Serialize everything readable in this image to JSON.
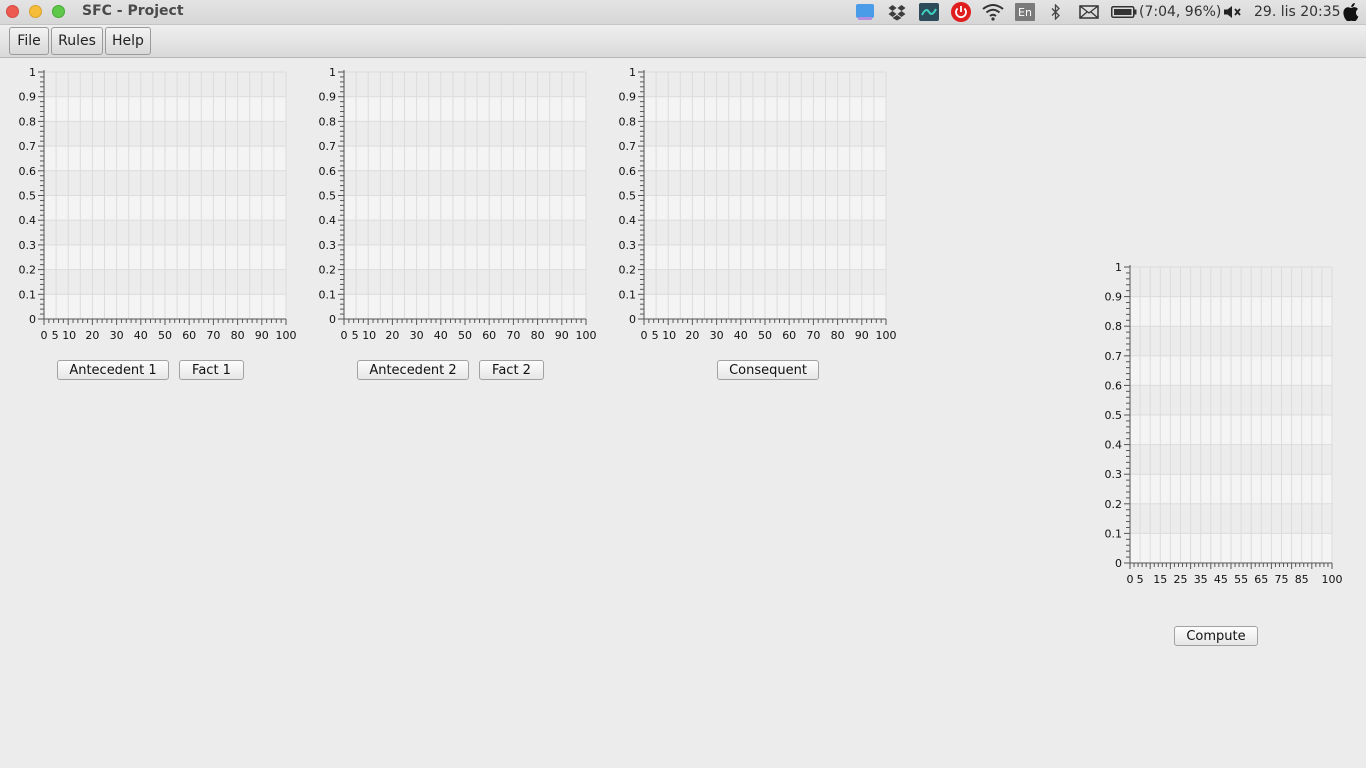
{
  "window": {
    "title": "SFC - Project"
  },
  "system_tray": {
    "keyboard_layout": "En",
    "battery_text": "(7:04, 96%)",
    "clock": "29. lis 20:35",
    "icons": [
      "files-icon",
      "dropbox-icon",
      "monitor-icon",
      "power-icon",
      "wifi-icon",
      "keyboard-icon",
      "bluetooth-icon",
      "mail-icon",
      "battery-icon",
      "volume-muted-icon",
      "apple-icon"
    ]
  },
  "menu": {
    "items": [
      "File",
      "Rules",
      "Help"
    ]
  },
  "buttons": {
    "antecedent1": "Antecedent 1",
    "fact1": "Fact 1",
    "antecedent2": "Antecedent 2",
    "fact2": "Fact 2",
    "consequent": "Consequent",
    "compute": "Compute"
  },
  "chart_data": [
    {
      "type": "line",
      "series": [],
      "xlim": [
        0,
        100
      ],
      "ylim": [
        0,
        1
      ],
      "x_tick_labels": [
        "0",
        "5",
        "10",
        "20",
        "30",
        "40",
        "50",
        "60",
        "70",
        "80",
        "90",
        "100"
      ],
      "y_tick_labels": [
        "0",
        "0.1",
        "0.2",
        "0.3",
        "0.4",
        "0.5",
        "0.6",
        "0.7",
        "0.8",
        "0.9",
        "1"
      ],
      "grid": true
    },
    {
      "type": "line",
      "series": [],
      "xlim": [
        0,
        100
      ],
      "ylim": [
        0,
        1
      ],
      "x_tick_labels": [
        "0",
        "5",
        "10",
        "20",
        "30",
        "40",
        "50",
        "60",
        "70",
        "80",
        "90",
        "100"
      ],
      "y_tick_labels": [
        "0",
        "0.1",
        "0.2",
        "0.3",
        "0.4",
        "0.5",
        "0.6",
        "0.7",
        "0.8",
        "0.9",
        "1"
      ],
      "grid": true
    },
    {
      "type": "line",
      "series": [],
      "xlim": [
        0,
        100
      ],
      "ylim": [
        0,
        1
      ],
      "x_tick_labels": [
        "0",
        "5",
        "10",
        "20",
        "30",
        "40",
        "50",
        "60",
        "70",
        "80",
        "90",
        "100"
      ],
      "y_tick_labels": [
        "0",
        "0.1",
        "0.2",
        "0.3",
        "0.4",
        "0.5",
        "0.6",
        "0.7",
        "0.8",
        "0.9",
        "1"
      ],
      "grid": true
    },
    {
      "type": "line",
      "series": [],
      "xlim": [
        0,
        100
      ],
      "ylim": [
        0,
        1
      ],
      "x_tick_labels": [
        "0",
        "5",
        "15",
        "25",
        "35",
        "45",
        "55",
        "65",
        "75",
        "85",
        "100"
      ],
      "y_tick_labels": [
        "0",
        "0.1",
        "0.2",
        "0.3",
        "0.4",
        "0.5",
        "0.6",
        "0.7",
        "0.8",
        "0.9",
        "1"
      ],
      "grid": true
    }
  ]
}
